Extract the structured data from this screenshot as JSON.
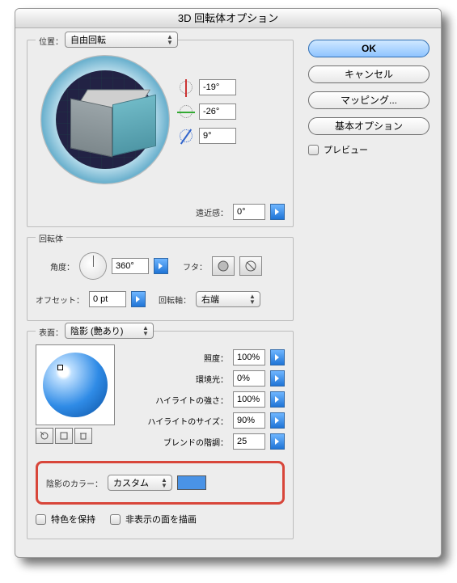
{
  "title": "3D 回転体オプション",
  "buttons": {
    "ok": "OK",
    "cancel": "キャンセル",
    "mapping": "マッピング...",
    "basic": "基本オプション",
    "preview": "プレビュー"
  },
  "position": {
    "group_label": "位置：",
    "preset": "自由回転",
    "angle_x": "-19°",
    "angle_y": "-26°",
    "angle_z": "9°",
    "perspective_label": "遠近感：",
    "perspective_value": "0°"
  },
  "revolve": {
    "group_label": "回転体",
    "angle_label": "角度：",
    "angle_value": "360°",
    "cap_label": "フタ：",
    "offset_label": "オフセット：",
    "offset_value": "0 pt",
    "axis_label": "回転軸：",
    "axis_value": "右端"
  },
  "surface": {
    "group_label": "表面：",
    "shading": "陰影 (艶あり)",
    "light_intensity_label": "照度：",
    "light_intensity": "100%",
    "ambient_label": "環境光：",
    "ambient": "0%",
    "highlight_intensity_label": "ハイライトの強さ：",
    "highlight_intensity": "100%",
    "highlight_size_label": "ハイライトのサイズ：",
    "highlight_size": "90%",
    "blend_steps_label": "ブレンドの階調：",
    "blend_steps": "25",
    "shade_color_label": "陰影のカラー：",
    "shade_color_mode": "カスタム",
    "shade_color_hex": "#4a93e6",
    "preserve_spot": "特色を保持",
    "draw_hidden": "非表示の面を描画"
  }
}
